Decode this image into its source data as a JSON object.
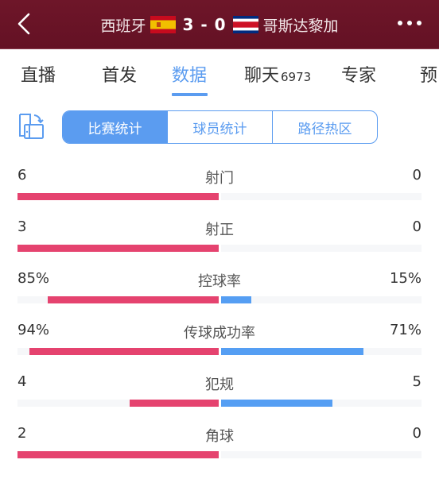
{
  "header": {
    "home_team": "西班牙",
    "away_team": "哥斯达黎加",
    "score": "3 - 0",
    "home_flag": "spain-flag",
    "away_flag": "costa-rica-flag",
    "background_color": "#6a1327"
  },
  "tabs": [
    {
      "label": "直播",
      "active": false
    },
    {
      "label": "首发",
      "active": false
    },
    {
      "label": "数据",
      "active": true
    },
    {
      "label": "聊天",
      "count": "6973",
      "active": false
    },
    {
      "label": "专家",
      "active": false
    },
    {
      "label": "预",
      "active": false
    }
  ],
  "segments": [
    {
      "label": "比赛统计",
      "active": true
    },
    {
      "label": "球员统计",
      "active": false
    },
    {
      "label": "路径热区",
      "active": false
    }
  ],
  "colors": {
    "accent": "#5b9cf0",
    "home_bar": "#e5436f",
    "away_bar": "#559ef3",
    "track": "#f6f7f9"
  },
  "stats": [
    {
      "label": "射门",
      "home": "6",
      "away": "0",
      "home_share": 1.0,
      "away_share": 0.0
    },
    {
      "label": "射正",
      "home": "3",
      "away": "0",
      "home_share": 1.0,
      "away_share": 0.0
    },
    {
      "label": "控球率",
      "home": "85%",
      "away": "15%",
      "home_share": 0.85,
      "away_share": 0.15
    },
    {
      "label": "传球成功率",
      "home": "94%",
      "away": "71%",
      "home_share": 0.94,
      "away_share": 0.71
    },
    {
      "label": "犯规",
      "home": "4",
      "away": "5",
      "home_share": 0.444,
      "away_share": 0.556
    },
    {
      "label": "角球",
      "home": "2",
      "away": "0",
      "home_share": 1.0,
      "away_share": 0.0
    }
  ]
}
